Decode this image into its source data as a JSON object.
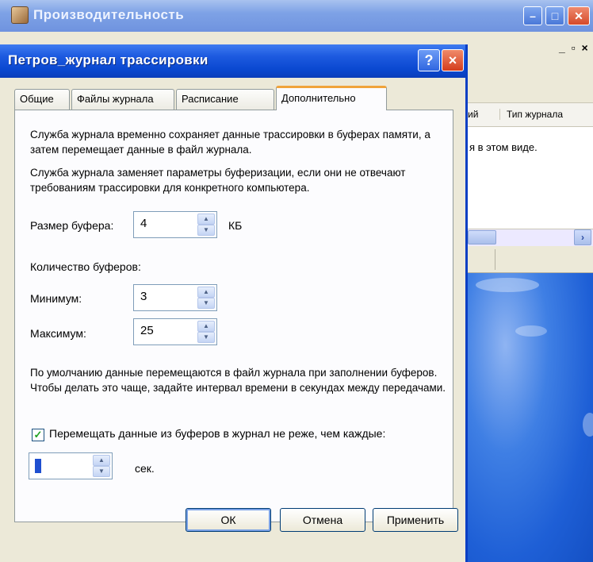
{
  "background_window": {
    "title": "Производительность",
    "mdi_controls": "_ ̸ ×",
    "column_1": "ий",
    "column_2": "Тип журнала",
    "empty_text": "я в этом виде."
  },
  "dialog": {
    "title": "Петров_журнал трассировки",
    "help_label": "?",
    "close_label": "×",
    "tabs": [
      {
        "label": "Общие",
        "active": false
      },
      {
        "label": "Файлы журнала",
        "active": false
      },
      {
        "label": "Расписание",
        "active": false
      },
      {
        "label": "Дополнительно",
        "active": true
      }
    ],
    "paragraph_1": "Служба журнала временно сохраняет данные трассировки в буферах памяти, а затем перемещает данные в файл журнала.",
    "paragraph_2": "Служба журнала заменяет параметры буферизации, если они не отвечают требованиям трассировки для конкретного компьютера.",
    "buffer_size": {
      "label": "Размер буфера:",
      "value": "4",
      "unit": "КБ"
    },
    "buffer_count_label": "Количество буферов:",
    "minimum": {
      "label": "Минимум:",
      "value": "3"
    },
    "maximum": {
      "label": "Максимум:",
      "value": "25"
    },
    "paragraph_3": "По умолчанию данные перемещаются в файл журнала при заполнении буферов. Чтобы делать это чаще, задайте интервал времени в секундах между передачами.",
    "flush_checkbox": {
      "label": "Перемещать данные из буферов в журнал не реже, чем каждые:",
      "checked": true,
      "mark": "✓"
    },
    "interval": {
      "value": "",
      "unit": "сек."
    },
    "buttons": {
      "ok": "ОК",
      "cancel": "Отмена",
      "apply": "Применить"
    }
  },
  "colors": {
    "titlebar_blue": "#0a48d0",
    "close_red": "#d43c1c",
    "active_tab_accent": "#f0a33a",
    "dialog_bg": "#ece9d8"
  }
}
